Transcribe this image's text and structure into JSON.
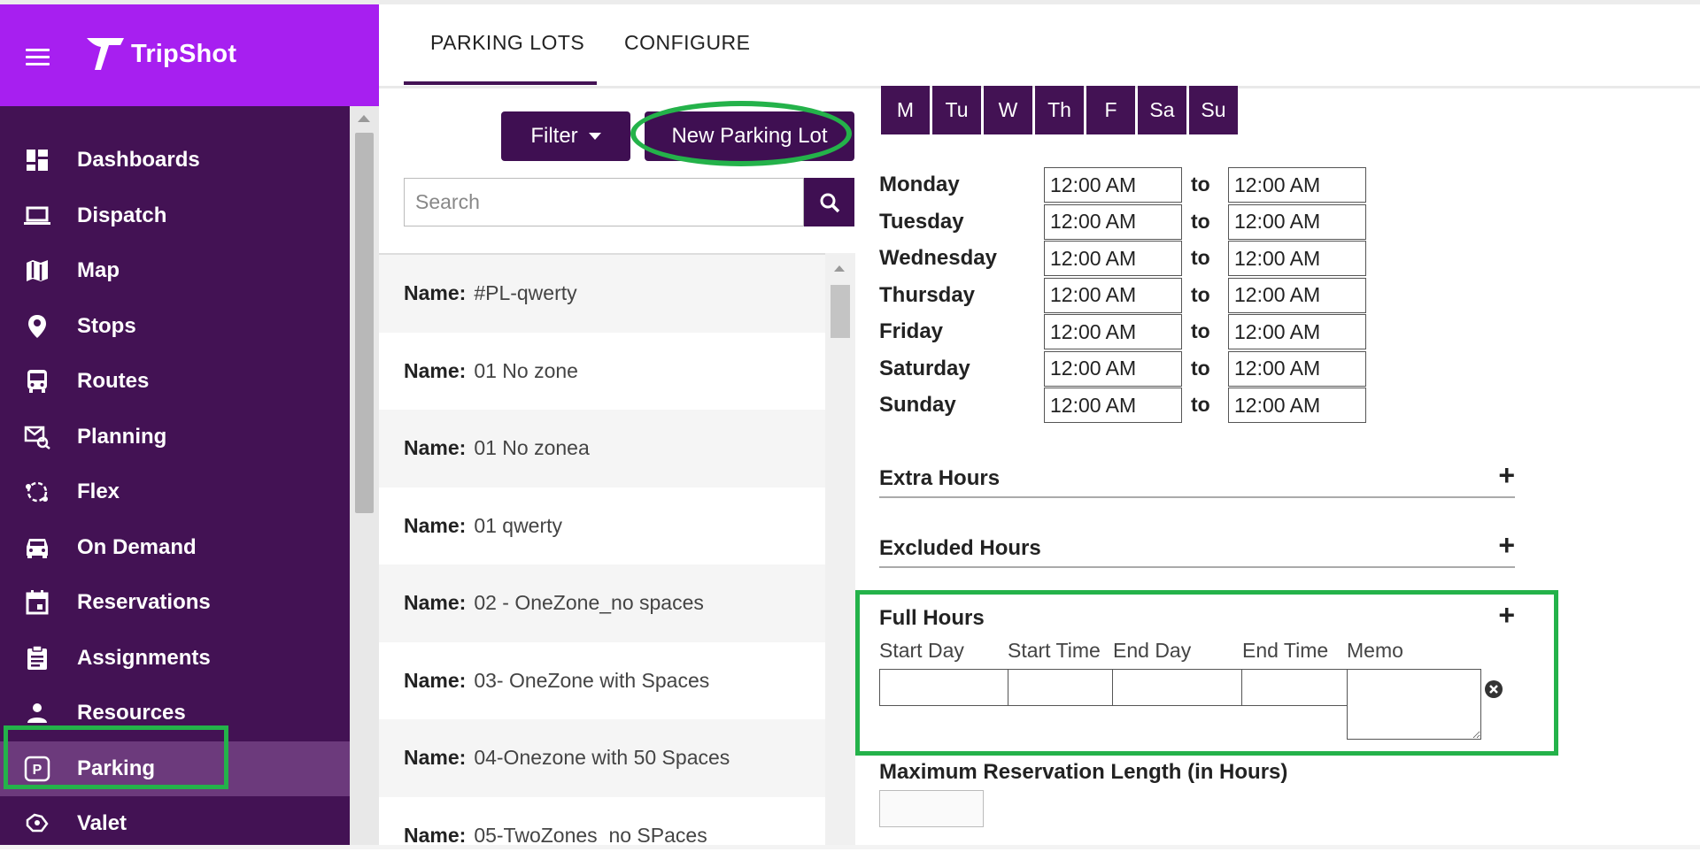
{
  "app": {
    "name": "TripShot"
  },
  "sidebar": {
    "items": [
      {
        "label": "Dashboards",
        "icon": "dashboard-icon"
      },
      {
        "label": "Dispatch",
        "icon": "laptop-icon"
      },
      {
        "label": "Map",
        "icon": "map-icon"
      },
      {
        "label": "Stops",
        "icon": "location-pin-icon"
      },
      {
        "label": "Routes",
        "icon": "bus-icon"
      },
      {
        "label": "Planning",
        "icon": "planning-icon"
      },
      {
        "label": "Flex",
        "icon": "flex-icon"
      },
      {
        "label": "On Demand",
        "icon": "car-icon"
      },
      {
        "label": "Reservations",
        "icon": "calendar-icon"
      },
      {
        "label": "Assignments",
        "icon": "clipboard-icon"
      },
      {
        "label": "Resources",
        "icon": "person-icon"
      },
      {
        "label": "Parking",
        "icon": "parking-icon",
        "active": true
      },
      {
        "label": "Valet",
        "icon": "valet-icon"
      }
    ]
  },
  "tabs": [
    {
      "label": "PARKING LOTS",
      "active": true
    },
    {
      "label": "CONFIGURE",
      "active": false
    }
  ],
  "toolbar": {
    "filter_label": "Filter",
    "new_label": "New Parking Lot"
  },
  "search": {
    "placeholder": "Search"
  },
  "list": {
    "name_label": "Name:",
    "items": [
      "#PL-qwerty",
      "01 No zone",
      "01 No zonea",
      "01 qwerty",
      "02 - OneZone_no spaces",
      "03- OneZone with Spaces",
      "04-Onezone with 50 Spaces",
      "05-TwoZones_no SPaces"
    ]
  },
  "days": [
    "M",
    "Tu",
    "W",
    "Th",
    "F",
    "Sa",
    "Su"
  ],
  "schedule": {
    "to_label": "to",
    "rows": [
      {
        "day": "Monday",
        "from": "12:00 AM",
        "to": "12:00 AM"
      },
      {
        "day": "Tuesday",
        "from": "12:00 AM",
        "to": "12:00 AM"
      },
      {
        "day": "Wednesday",
        "from": "12:00 AM",
        "to": "12:00 AM"
      },
      {
        "day": "Thursday",
        "from": "12:00 AM",
        "to": "12:00 AM"
      },
      {
        "day": "Friday",
        "from": "12:00 AM",
        "to": "12:00 AM"
      },
      {
        "day": "Saturday",
        "from": "12:00 AM",
        "to": "12:00 AM"
      },
      {
        "day": "Sunday",
        "from": "12:00 AM",
        "to": "12:00 AM"
      }
    ]
  },
  "sections": {
    "extra_hours": "Extra Hours",
    "excluded_hours": "Excluded Hours",
    "full_hours": "Full Hours",
    "plus": "+"
  },
  "full_hours_columns": [
    "Start Day",
    "Start Time",
    "End Day",
    "End Time",
    "Memo"
  ],
  "max_reservation": {
    "label": "Maximum Reservation Length (in Hours)",
    "value": ""
  },
  "colors": {
    "sidebar": "#431254",
    "brand": "#a71ff0",
    "accent": "#3f0f52",
    "highlight": "#24b24a"
  }
}
